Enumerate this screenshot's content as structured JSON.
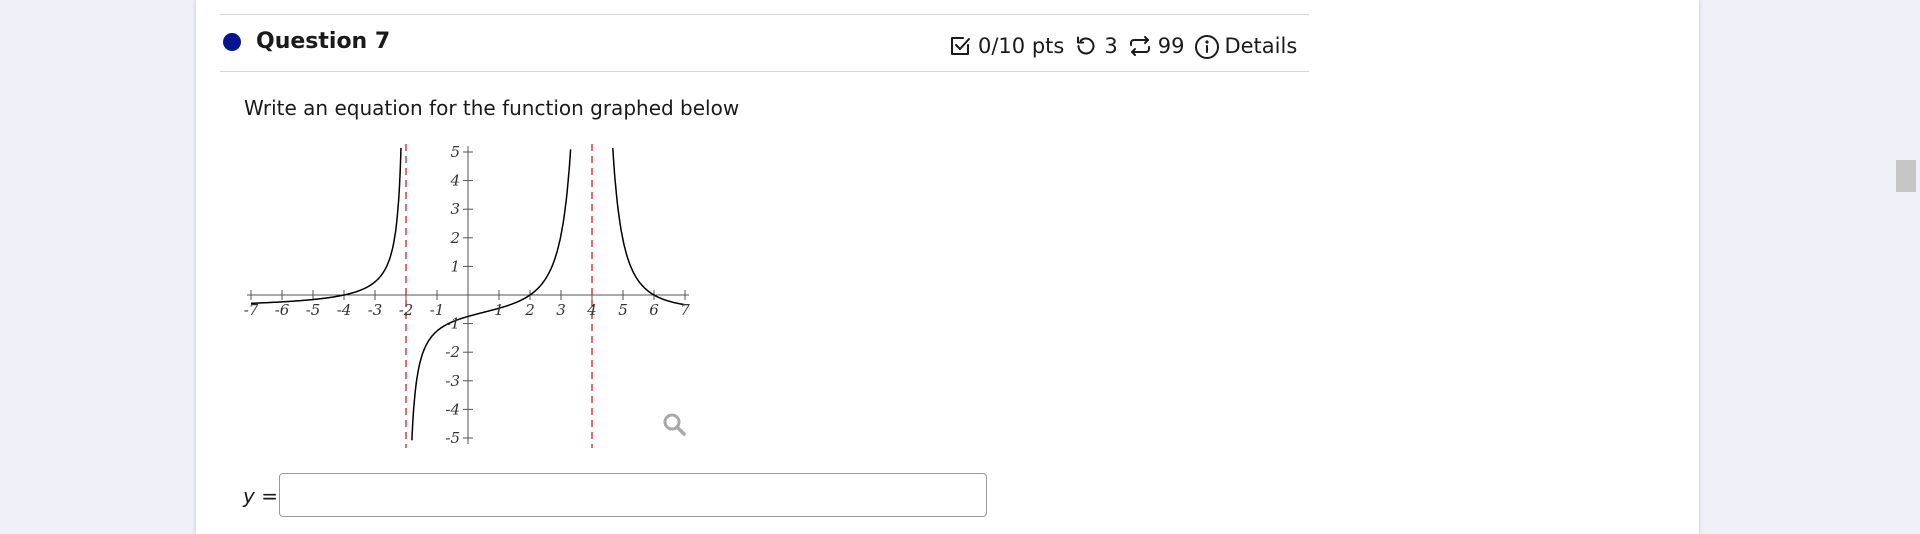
{
  "question": {
    "title": "Question 7",
    "points": "0/10 pts",
    "attempts": "3",
    "regenerations": "99",
    "details_label": "Details",
    "prompt": "Write an equation for the function graphed below"
  },
  "colors": {
    "page_background": "#eff0f8",
    "status_dot": "#05158f",
    "asymptote": "#e8141e",
    "curve": "#000000"
  },
  "icons": {
    "points": "checkbox-icon",
    "attempts": "retry-icon",
    "regenerations": "repeat-icon",
    "details": "info-icon",
    "zoom": "magnifier-icon"
  },
  "graph": {
    "x_ticks": [
      -7,
      -6,
      -5,
      -4,
      -3,
      -2,
      -1,
      1,
      2,
      3,
      4,
      5,
      6,
      7
    ],
    "y_ticks": [
      5,
      4,
      3,
      2,
      1,
      -1,
      -2,
      -3,
      -4,
      -5
    ],
    "x_range": [
      -7,
      7
    ],
    "y_range": [
      -5,
      5
    ],
    "vertical_asymptotes": [
      -2,
      4
    ]
  },
  "answer": {
    "variable": "y",
    "equals": "=",
    "value": ""
  }
}
